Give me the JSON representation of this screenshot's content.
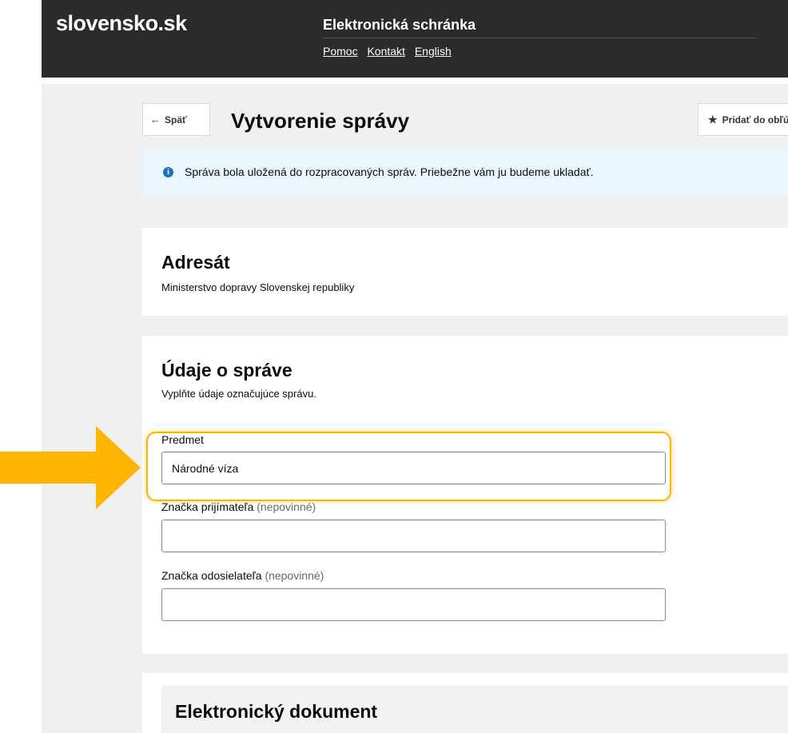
{
  "header": {
    "logo": "slovensko.sk",
    "service_name": "Elektronická schránka",
    "nav": {
      "help": "Pomoc",
      "contact": "Kontakt",
      "language": "English"
    }
  },
  "toolbar": {
    "back_label": "Späť",
    "page_title": "Vytvorenie správy",
    "favorite_label": "Pridať do obľúbených"
  },
  "info_banner": {
    "icon": "info-icon",
    "text": "Správa bola uložená do rozpracovaných správ. Priebežne vám ju budeme ukladať."
  },
  "addressee": {
    "heading": "Adresát",
    "name": "Ministerstvo dopravy Slovenskej republiky"
  },
  "message_details": {
    "heading": "Údaje o správe",
    "subtitle": "Vyplňte údaje označujúce správu.",
    "fields": {
      "subject": {
        "label": "Predmet",
        "value": "Národné víza"
      },
      "recipient_ref": {
        "label": "Značka prijímateľa",
        "optional": "(nepovinné)",
        "value": ""
      },
      "sender_ref": {
        "label": "Značka odosielateľa",
        "optional": "(nepovinné)",
        "value": ""
      }
    }
  },
  "document": {
    "heading": "Elektronický dokument"
  },
  "colors": {
    "header_bg": "#2b2b2b",
    "flag_blue": "#1d4ba0",
    "flag_red": "#d4232a",
    "info_bg": "#eaf6fd",
    "info_icon": "#1d70b8",
    "highlight": "#ffb400"
  }
}
